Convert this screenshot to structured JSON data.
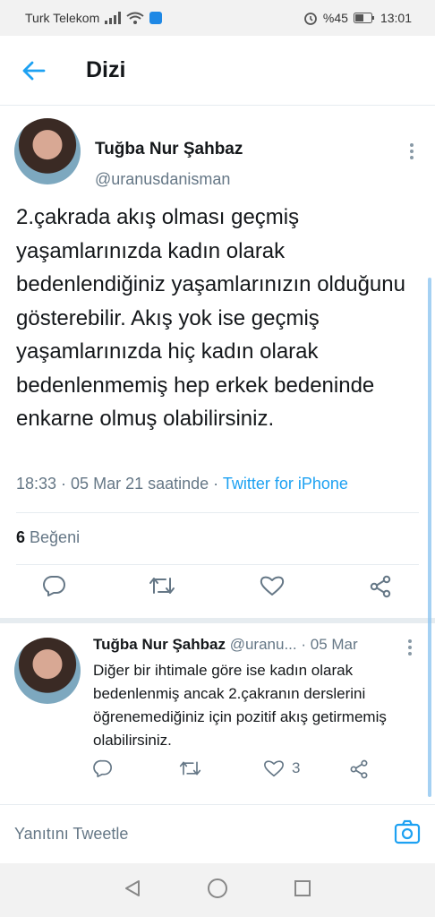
{
  "status_bar": {
    "carrier": "Turk Telekom",
    "battery": "%45",
    "time": "13:01"
  },
  "header": {
    "title": "Dizi"
  },
  "tweet": {
    "author": "Tuğba Nur Şahbaz",
    "handle": "@uranusdanisman",
    "text": "2.çakrada akış olması geçmiş yaşamlarınızda kadın olarak bedenlendiğiniz yaşamlarınızın olduğunu gösterebilir. Akış yok ise geçmiş yaşamlarınızda hiç kadın olarak bedenlenmemiş hep erkek bedeninde enkarne olmuş olabilirsiniz.",
    "time": "18:33",
    "date": "05 Mar 21 saatinde",
    "source": "Twitter for iPhone",
    "likes_count": "6",
    "likes_label": "Beğeni"
  },
  "reply": {
    "author": "Tuğba Nur Şahbaz",
    "handle": "@uranu...",
    "date": "05 Mar",
    "text": "Diğer bir ihtimale göre ise kadın olarak bedenlenmiş ancak 2.çakranın derslerini öğrenemediğiniz için pozitif akış getirmemiş olabilirsiniz.",
    "like_count": "3"
  },
  "compose": {
    "placeholder": "Yanıtını Tweetle"
  },
  "colors": {
    "accent": "#1da1f2",
    "muted": "#657786",
    "divider": "#e6ecf0"
  }
}
